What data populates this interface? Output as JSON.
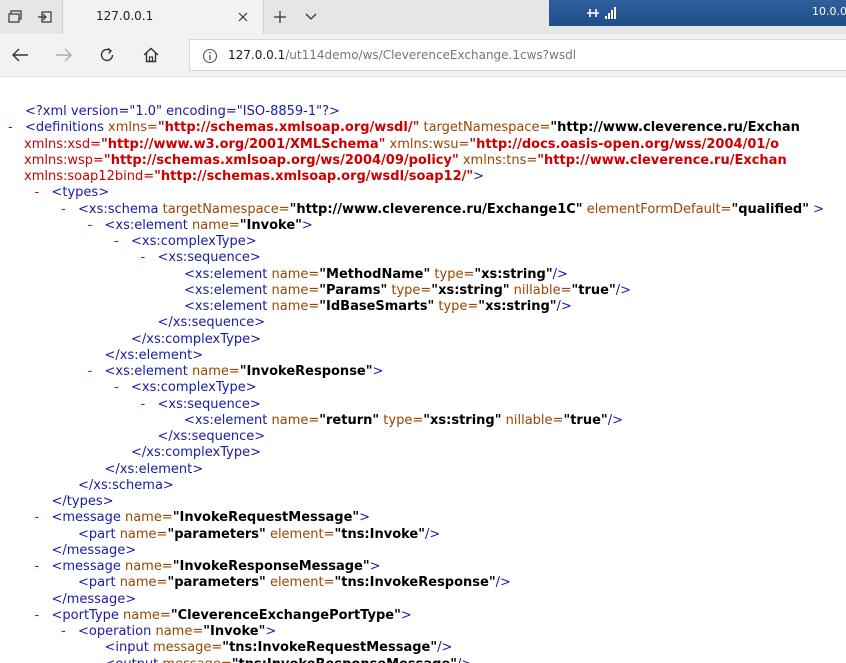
{
  "tab": {
    "title": "127.0.0.1"
  },
  "icons": {
    "tab_manage": "tab-manage-icon",
    "set_aside": "set-aside-tabs-icon",
    "close": "close-icon",
    "new_tab": "plus-icon",
    "tab_list": "chevron-down-icon"
  },
  "tray": {
    "text": "10.0.0"
  },
  "address": {
    "host": "127.0.0.1",
    "path": "/ut114demo/ws/CleverenceExchange.1cws?wsdl"
  },
  "xml_lines": [
    {
      "indent": 0,
      "toggle": false,
      "kind": "pi",
      "text": "<?xml version=\"1.0\" encoding=\"ISO-8859-1\"?>"
    },
    {
      "indent": 0,
      "toggle": true,
      "kind": "mixed",
      "parts": [
        {
          "c": "tag",
          "t": "<definitions "
        },
        {
          "c": "an",
          "t": "xmlns="
        },
        {
          "c": "nsv",
          "t": "\"http://schemas.xmlsoap.org/wsdl/\""
        },
        {
          "c": "an",
          "t": " targetNamespace="
        },
        {
          "c": "av",
          "t": "\"http://www.cleverence.ru/Exchan"
        }
      ]
    },
    {
      "indent": -1,
      "toggle": false,
      "kind": "mixed",
      "parts": [
        {
          "c": "ns",
          "t": "xmlns:xsd="
        },
        {
          "c": "nsv",
          "t": "\"http://www.w3.org/2001/XMLSchema\""
        },
        {
          "c": "an",
          "t": " xmlns:wsu="
        },
        {
          "c": "nsv",
          "t": "\"http://docs.oasis-open.org/wss/2004/01/o"
        }
      ]
    },
    {
      "indent": -1,
      "toggle": false,
      "kind": "mixed",
      "parts": [
        {
          "c": "ns",
          "t": "xmlns:wsp="
        },
        {
          "c": "nsv",
          "t": "\"http://schemas.xmlsoap.org/ws/2004/09/policy\""
        },
        {
          "c": "an",
          "t": " xmlns:tns="
        },
        {
          "c": "nsv",
          "t": "\"http://www.cleverence.ru/Exchan"
        }
      ]
    },
    {
      "indent": -1,
      "toggle": false,
      "kind": "mixed",
      "parts": [
        {
          "c": "ns",
          "t": "xmlns:soap12bind="
        },
        {
          "c": "nsv",
          "t": "\"http://schemas.xmlsoap.org/wsdl/soap12/\""
        },
        {
          "c": "tag",
          "t": ">"
        }
      ]
    },
    {
      "indent": 1,
      "toggle": true,
      "kind": "mixed",
      "parts": [
        {
          "c": "tag",
          "t": "<types>"
        }
      ]
    },
    {
      "indent": 2,
      "toggle": true,
      "kind": "mixed",
      "parts": [
        {
          "c": "tag",
          "t": "<xs:schema "
        },
        {
          "c": "an",
          "t": "targetNamespace="
        },
        {
          "c": "av",
          "t": "\"http://www.cleverence.ru/Exchange1C\""
        },
        {
          "c": "an",
          "t": " elementFormDefault="
        },
        {
          "c": "av",
          "t": "\"qualified\""
        },
        {
          "c": "tag",
          "t": " >"
        }
      ]
    },
    {
      "indent": 3,
      "toggle": true,
      "kind": "mixed",
      "parts": [
        {
          "c": "tag",
          "t": "<xs:element "
        },
        {
          "c": "an",
          "t": "name="
        },
        {
          "c": "av",
          "t": "\"Invoke\""
        },
        {
          "c": "tag",
          "t": ">"
        }
      ]
    },
    {
      "indent": 4,
      "toggle": true,
      "kind": "mixed",
      "parts": [
        {
          "c": "tag",
          "t": "<xs:complexType>"
        }
      ]
    },
    {
      "indent": 5,
      "toggle": true,
      "kind": "mixed",
      "parts": [
        {
          "c": "tag",
          "t": "<xs:sequence>"
        }
      ]
    },
    {
      "indent": 6,
      "toggle": false,
      "kind": "mixed",
      "parts": [
        {
          "c": "tag",
          "t": "<xs:element "
        },
        {
          "c": "an",
          "t": "name="
        },
        {
          "c": "av",
          "t": "\"MethodName\""
        },
        {
          "c": "an",
          "t": " type="
        },
        {
          "c": "av",
          "t": "\"xs:string\""
        },
        {
          "c": "tag",
          "t": "/>"
        }
      ]
    },
    {
      "indent": 6,
      "toggle": false,
      "kind": "mixed",
      "parts": [
        {
          "c": "tag",
          "t": "<xs:element "
        },
        {
          "c": "an",
          "t": "name="
        },
        {
          "c": "av",
          "t": "\"Params\""
        },
        {
          "c": "an",
          "t": " type="
        },
        {
          "c": "av",
          "t": "\"xs:string\""
        },
        {
          "c": "an",
          "t": " nillable="
        },
        {
          "c": "av",
          "t": "\"true\""
        },
        {
          "c": "tag",
          "t": "/>"
        }
      ]
    },
    {
      "indent": 6,
      "toggle": false,
      "kind": "mixed",
      "parts": [
        {
          "c": "tag",
          "t": "<xs:element "
        },
        {
          "c": "an",
          "t": "name="
        },
        {
          "c": "av",
          "t": "\"IdBaseSmarts\""
        },
        {
          "c": "an",
          "t": " type="
        },
        {
          "c": "av",
          "t": "\"xs:string\""
        },
        {
          "c": "tag",
          "t": "/>"
        }
      ]
    },
    {
      "indent": 5,
      "toggle": false,
      "kind": "mixed",
      "parts": [
        {
          "c": "tag",
          "t": "</xs:sequence>"
        }
      ]
    },
    {
      "indent": 4,
      "toggle": false,
      "kind": "mixed",
      "parts": [
        {
          "c": "tag",
          "t": "</xs:complexType>"
        }
      ]
    },
    {
      "indent": 3,
      "toggle": false,
      "kind": "mixed",
      "parts": [
        {
          "c": "tag",
          "t": "</xs:element>"
        }
      ]
    },
    {
      "indent": 3,
      "toggle": true,
      "kind": "mixed",
      "parts": [
        {
          "c": "tag",
          "t": "<xs:element "
        },
        {
          "c": "an",
          "t": "name="
        },
        {
          "c": "av",
          "t": "\"InvokeResponse\""
        },
        {
          "c": "tag",
          "t": ">"
        }
      ]
    },
    {
      "indent": 4,
      "toggle": true,
      "kind": "mixed",
      "parts": [
        {
          "c": "tag",
          "t": "<xs:complexType>"
        }
      ]
    },
    {
      "indent": 5,
      "toggle": true,
      "kind": "mixed",
      "parts": [
        {
          "c": "tag",
          "t": "<xs:sequence>"
        }
      ]
    },
    {
      "indent": 6,
      "toggle": false,
      "kind": "mixed",
      "parts": [
        {
          "c": "tag",
          "t": "<xs:element "
        },
        {
          "c": "an",
          "t": "name="
        },
        {
          "c": "av",
          "t": "\"return\""
        },
        {
          "c": "an",
          "t": " type="
        },
        {
          "c": "av",
          "t": "\"xs:string\""
        },
        {
          "c": "an",
          "t": " nillable="
        },
        {
          "c": "av",
          "t": "\"true\""
        },
        {
          "c": "tag",
          "t": "/>"
        }
      ]
    },
    {
      "indent": 5,
      "toggle": false,
      "kind": "mixed",
      "parts": [
        {
          "c": "tag",
          "t": "</xs:sequence>"
        }
      ]
    },
    {
      "indent": 4,
      "toggle": false,
      "kind": "mixed",
      "parts": [
        {
          "c": "tag",
          "t": "</xs:complexType>"
        }
      ]
    },
    {
      "indent": 3,
      "toggle": false,
      "kind": "mixed",
      "parts": [
        {
          "c": "tag",
          "t": "</xs:element>"
        }
      ]
    },
    {
      "indent": 2,
      "toggle": false,
      "kind": "mixed",
      "parts": [
        {
          "c": "tag",
          "t": "</xs:schema>"
        }
      ]
    },
    {
      "indent": 1,
      "toggle": false,
      "kind": "mixed",
      "parts": [
        {
          "c": "tag",
          "t": "</types>"
        }
      ]
    },
    {
      "indent": 1,
      "toggle": true,
      "kind": "mixed",
      "parts": [
        {
          "c": "tag",
          "t": "<message "
        },
        {
          "c": "an",
          "t": "name="
        },
        {
          "c": "av",
          "t": "\"InvokeRequestMessage\""
        },
        {
          "c": "tag",
          "t": ">"
        }
      ]
    },
    {
      "indent": 2,
      "toggle": false,
      "kind": "mixed",
      "parts": [
        {
          "c": "tag",
          "t": "<part "
        },
        {
          "c": "an",
          "t": "name="
        },
        {
          "c": "av",
          "t": "\"parameters\""
        },
        {
          "c": "an",
          "t": " element="
        },
        {
          "c": "av",
          "t": "\"tns:Invoke\""
        },
        {
          "c": "tag",
          "t": "/>"
        }
      ]
    },
    {
      "indent": 1,
      "toggle": false,
      "kind": "mixed",
      "parts": [
        {
          "c": "tag",
          "t": "</message>"
        }
      ]
    },
    {
      "indent": 1,
      "toggle": true,
      "kind": "mixed",
      "parts": [
        {
          "c": "tag",
          "t": "<message "
        },
        {
          "c": "an",
          "t": "name="
        },
        {
          "c": "av",
          "t": "\"InvokeResponseMessage\""
        },
        {
          "c": "tag",
          "t": ">"
        }
      ]
    },
    {
      "indent": 2,
      "toggle": false,
      "kind": "mixed",
      "parts": [
        {
          "c": "tag",
          "t": "<part "
        },
        {
          "c": "an",
          "t": "name="
        },
        {
          "c": "av",
          "t": "\"parameters\""
        },
        {
          "c": "an",
          "t": " element="
        },
        {
          "c": "av",
          "t": "\"tns:InvokeResponse\""
        },
        {
          "c": "tag",
          "t": "/>"
        }
      ]
    },
    {
      "indent": 1,
      "toggle": false,
      "kind": "mixed",
      "parts": [
        {
          "c": "tag",
          "t": "</message>"
        }
      ]
    },
    {
      "indent": 1,
      "toggle": true,
      "kind": "mixed",
      "parts": [
        {
          "c": "tag",
          "t": "<portType "
        },
        {
          "c": "an",
          "t": "name="
        },
        {
          "c": "av",
          "t": "\"CleverenceExchangePortType\""
        },
        {
          "c": "tag",
          "t": ">"
        }
      ]
    },
    {
      "indent": 2,
      "toggle": true,
      "kind": "mixed",
      "parts": [
        {
          "c": "tag",
          "t": "<operation "
        },
        {
          "c": "an",
          "t": "name="
        },
        {
          "c": "av",
          "t": "\"Invoke\""
        },
        {
          "c": "tag",
          "t": ">"
        }
      ]
    },
    {
      "indent": 3,
      "toggle": false,
      "kind": "mixed",
      "parts": [
        {
          "c": "tag",
          "t": "<input "
        },
        {
          "c": "an",
          "t": "message="
        },
        {
          "c": "av",
          "t": "\"tns:InvokeRequestMessage\""
        },
        {
          "c": "tag",
          "t": "/>"
        }
      ]
    },
    {
      "indent": 3,
      "toggle": false,
      "kind": "mixed",
      "parts": [
        {
          "c": "tag",
          "t": "<output "
        },
        {
          "c": "an",
          "t": "message="
        },
        {
          "c": "av",
          "t": "\"tns:InvokeResponseMessage\""
        },
        {
          "c": "tag",
          "t": "/>"
        }
      ]
    }
  ]
}
